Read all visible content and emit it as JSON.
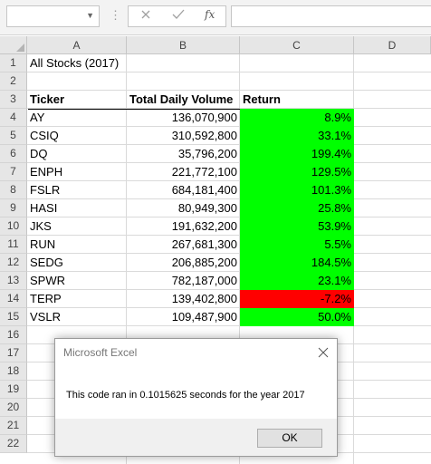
{
  "formula_bar": {
    "name_box_value": "",
    "formula_value": "",
    "cancel_icon": "x-icon",
    "enter_icon": "check-icon",
    "insert_function_label": "fx"
  },
  "columns": [
    "A",
    "B",
    "C",
    "D"
  ],
  "rows": [
    "1",
    "2",
    "3",
    "4",
    "5",
    "6",
    "7",
    "8",
    "9",
    "10",
    "11",
    "12",
    "13",
    "14",
    "15",
    "16",
    "17",
    "18",
    "19",
    "20",
    "21",
    "22"
  ],
  "sheet": {
    "title": "All Stocks (2017)",
    "headers": {
      "ticker": "Ticker",
      "volume": "Total Daily Volume",
      "return": "Return"
    },
    "data": [
      {
        "ticker": "AY",
        "volume": "136,070,900",
        "return": "8.9%",
        "positive": true
      },
      {
        "ticker": "CSIQ",
        "volume": "310,592,800",
        "return": "33.1%",
        "positive": true
      },
      {
        "ticker": "DQ",
        "volume": "35,796,200",
        "return": "199.4%",
        "positive": true
      },
      {
        "ticker": "ENPH",
        "volume": "221,772,100",
        "return": "129.5%",
        "positive": true
      },
      {
        "ticker": "FSLR",
        "volume": "684,181,400",
        "return": "101.3%",
        "positive": true
      },
      {
        "ticker": "HASI",
        "volume": "80,949,300",
        "return": "25.8%",
        "positive": true
      },
      {
        "ticker": "JKS",
        "volume": "191,632,200",
        "return": "53.9%",
        "positive": true
      },
      {
        "ticker": "RUN",
        "volume": "267,681,300",
        "return": "5.5%",
        "positive": true
      },
      {
        "ticker": "SEDG",
        "volume": "206,885,200",
        "return": "184.5%",
        "positive": true
      },
      {
        "ticker": "SPWR",
        "volume": "782,187,000",
        "return": "23.1%",
        "positive": true
      },
      {
        "ticker": "TERP",
        "volume": "139,402,800",
        "return": "-7.2%",
        "positive": false
      },
      {
        "ticker": "VSLR",
        "volume": "109,487,900",
        "return": "50.0%",
        "positive": true
      }
    ]
  },
  "colors": {
    "positive": "#00ff00",
    "negative": "#ff0000"
  },
  "dialog": {
    "title": "Microsoft Excel",
    "message": "This code ran in 0.1015625 seconds for the year 2017",
    "ok_label": "OK",
    "close_icon": "close-icon"
  }
}
